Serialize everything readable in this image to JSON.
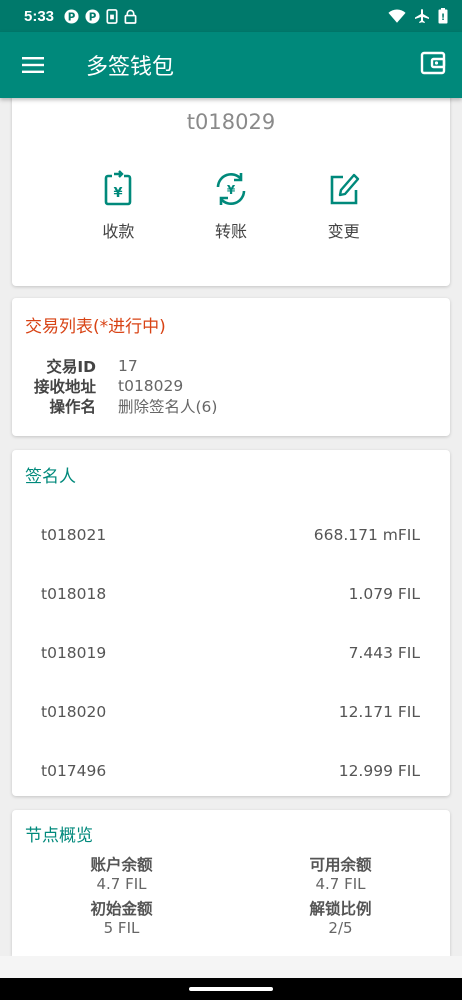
{
  "status_bar": {
    "time": "5:33",
    "icons": [
      "p-icon",
      "p-icon",
      "sim-icon",
      "lock-icon"
    ],
    "right_icons": [
      "wifi-icon",
      "airplane-icon",
      "battery-icon"
    ]
  },
  "app_bar": {
    "title": "多签钱包",
    "menu_icon": "menu-icon",
    "action_icon": "wallet-icon"
  },
  "wallet": {
    "address": "t018029",
    "actions": [
      {
        "label": "收款",
        "icon": "receive-icon"
      },
      {
        "label": "转账",
        "icon": "transfer-icon"
      },
      {
        "label": "变更",
        "icon": "edit-icon"
      }
    ]
  },
  "transactions": {
    "title": "交易列表(*进行中)",
    "fields": [
      {
        "key": "交易ID",
        "value": "17"
      },
      {
        "key": "接收地址",
        "value": "t018029"
      },
      {
        "key": "操作名",
        "value": "删除签名人(6)"
      }
    ]
  },
  "signers": {
    "title": "签名人",
    "items": [
      {
        "address": "t018021",
        "balance": "668.171 mFIL"
      },
      {
        "address": "t018018",
        "balance": "1.079 FIL"
      },
      {
        "address": "t018019",
        "balance": "7.443 FIL"
      },
      {
        "address": "t018020",
        "balance": "12.171 FIL"
      },
      {
        "address": "t017496",
        "balance": "12.999 FIL"
      }
    ]
  },
  "overview": {
    "title": "节点概览",
    "items": [
      {
        "key": "账户余额",
        "value": "4.7 FIL"
      },
      {
        "key": "可用余额",
        "value": "4.7 FIL"
      },
      {
        "key": "初始金额",
        "value": "5 FIL"
      },
      {
        "key": "解锁比例",
        "value": "2/5"
      }
    ]
  },
  "colors": {
    "primary": "#00897b",
    "primary_dark": "#00796b",
    "accent_red": "#d84315"
  }
}
